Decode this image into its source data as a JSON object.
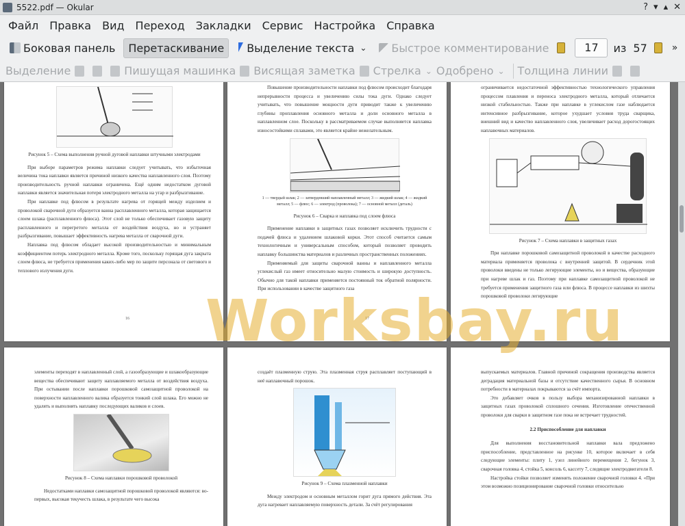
{
  "window": {
    "title": "5522.pdf — Okular"
  },
  "menu": [
    "Файл",
    "Правка",
    "Вид",
    "Переход",
    "Закладки",
    "Сервис",
    "Настройка",
    "Справка"
  ],
  "toolbar": {
    "sidebar": "Боковая панель",
    "drag": "Перетаскивание",
    "text_select": "Выделение текста",
    "quick_annot": "Быстрое комментирование",
    "current_page": "17",
    "of": "из",
    "total_pages": "57"
  },
  "annot_toolbar": {
    "select": "Выделение",
    "typewriter": "Пишущая машинка",
    "sticky": "Висящая заметка",
    "arrow": "Стрелка",
    "approved": "Одобрено",
    "line_width": "Толщина линии"
  },
  "watermark": "Worksbay.ru",
  "pages": {
    "p16": {
      "caption": "Рисунок 5 – Схема выполнения ручной дуговой наплавки штучными электродами",
      "para1": "При выборе параметров режима наплавки следует учитывать, что избыточная величина тока наплавки является причиной низкого качества наплавленного слоя. Поэтому производительность ручной наплавки ограничена. Ещё одним недостатком дуговой наплавки является значительная потеря электродного металла на угар и разбрызгивание.",
      "para2": "При наплавке под флюсом в результате нагрева от горящей между изделием и проволокой сварочной дуги образуется ванна расплавленного металла, которая защищается слоем шлака (расплавленного флюса). Этот слой не только обеспечивает газовую защиту расплавленного и перегретого металла от воздействия воздуха, но и устраняет разбрызгивание, повышает эффективность нагрева металла от сварочной дуги.",
      "para3": "Наплавка под флюсом обладает высокой производительностью и минимальным коэффициентом потерь электродного металла. Кроме того, поскольку горящая дуга закрыта слоем флюса, не требуется применения каких-либо мер по защите персонала от светового и теплового излучения дуги.",
      "num": "16"
    },
    "p17": {
      "para1": "Повышение производительности наплавки под флюсом происходит благодаря непрерывности процесса и увеличению силы тока дуги. Однако следует учитывать, что повышение мощности дуги приводит также к увеличению глубины проплавления основного металла и доли основного металла в наплавленном слое. Поскольку в рассматриваемом случае выполняется наплавка износостойкими сплавами, это является крайне нежелательным.",
      "legend": "1 — твердый шлак; 2 — затвердевший наплавленный металл; 3 — жидкий шлак; 4 — жидкий металл; 5 — флюс; 6 — электрод (проволока); 7 — основной металл (деталь)",
      "caption": "Рисунок 6 – Сварка и наплавка под слоем флюса",
      "para2": "Применение наплавки в защитных газах позволяет исключить трудности с подачей флюса и удалением шлаковой корки. Этот способ считается самым технологичным и универсальным способом, который позволяет проводить наплавку большинства материалов и различных пространственных положениях.",
      "para3": "Применяемый для защиты сварочной ванны и наплавленного металла углекислый газ имеет относительно малую стоимость и широкую доступность. Обычно для такой наплавки применяется постоянный ток обратной полярности. При использовании в качестве защитного газа",
      "num": "17"
    },
    "p18": {
      "para1": "ограничивается недостаточной эффективностью технологического управления процессом плавления и переноса электродного металла, который отличается низкой стабильностью. Также при наплавке в углекислом газе наблюдается интенсивное разбрызгивание, которое ухудшает условия труда сварщика, внешний вид и качество наплавленного слоя, увеличивает расход дорогостоящих наплавочных материалов.",
      "caption": "Рисунок 7 – Схема наплавки в защитных газах",
      "para2": "При наплавке порошковой самозащитной проволокой в качестве расходного материала применяется проволока с внутренней защитой. В сердечник этой проволоки введены не только легирующие элементы, но и вещества, образующие при нагреве шлак и газ. Поэтому при наплавке самозащитной проволокой не требуется применения защитного газа или флюса. В процессе наплавки из шихты порошковой проволоки легирующие"
    },
    "p19": {
      "para1": "элементы переходят в наплавленный слой, а газообразующие и шлакообразующие вещества обеспечивают защиту наплавляемого металла от воздействия воздуха. При остывании после наплавки порошковой самозащитной проволокой на поверхности наплавленного валика образуется тонкий слой шлака. Его можно не удалять и выполнять наплавку последующих валиков и слоев.",
      "caption": "Рисунок 8 – Схема наплавки порошковой проволокой",
      "para2": "Недостатками наплавки самозащитной порошковой проволокой являются: во-первых, высокая текучесть шлака, в результате чего высока"
    },
    "p20": {
      "para1": "создаёт плазменную струю. Эта плазменная струя расплавляет поступающий в неё наплавочный порошок.",
      "caption": "Рисунок 9 – Схема плазменной наплавки",
      "para2": "Между электродом и основным металлом горит дуга прямого действия. Эта дуга нагревает наплавляемую поверхность детали. За счёт регулирования"
    },
    "p21": {
      "para1": "выпускаемых материалов. Главной причиной сокращения производства является деградация материальной базы и отсутствие качественного сырья. В основном потребности в материалах покрываются за счёт импорта.",
      "para2": "Это добавляет очков в пользу выбора механизированной наплавки в защитных газах проволокой сплошного сечения. Изготовление отечественной проволоки для сварки в защитном газе пока не встречает трудностей.",
      "heading": "2.2 Приспособление для наплавки",
      "para3": "Для выполнения восстановительной наплавки вала предложено приспособление, представленное на рисунке 10, которое включает в себя следующие элементы: плиту 1, узел линейного перемещения 2, бегунок 3, сварочная головка 4, стойка 5, консоль 6, кассету 7, следящие электродвигатели 8.",
      "para4": "Настройка стойки позволяет изменять положение сварочной головки 4. «При этом возможно позиционирование сварочной головки относительно"
    }
  }
}
